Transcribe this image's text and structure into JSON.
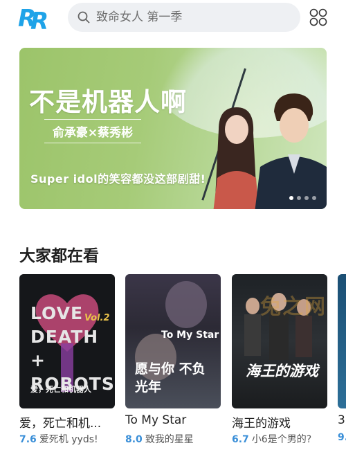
{
  "app": {
    "logo_text": "RR"
  },
  "search": {
    "placeholder": "致命女人 第一季"
  },
  "banner": {
    "title": "不是机器人啊",
    "subtitle": "俞承豪×蔡秀彬",
    "caption": "Super idol的笑容都没这部剧甜!",
    "dots_total": 4,
    "active_dot": 1
  },
  "section": {
    "title": "大家都在看"
  },
  "cards": [
    {
      "title": "爱，死亡和机...",
      "score": "7.6",
      "tagline": "爱死机 yyds!",
      "poster_text_main": "LOVE DEATH + ROBOTS",
      "poster_text_vol": "Vol.2",
      "poster_text_sub": "爱，死亡和机器人"
    },
    {
      "title": "To My Star",
      "score": "8.0",
      "tagline": "致我的星星",
      "poster_text_main": "To My Star",
      "poster_text_sub": "愿与你 不负光年"
    },
    {
      "title": "海王的游戏",
      "score": "6.7",
      "tagline": "小6是个男的?",
      "poster_text_main": "海王的游戏"
    },
    {
      "title": "3",
      "score": "9.",
      "tagline": ""
    }
  ],
  "watermark": "兔之网",
  "colors": {
    "score": "#3a8fd8",
    "logo": "#1fa3e8",
    "search_bg": "#eef0f3"
  }
}
